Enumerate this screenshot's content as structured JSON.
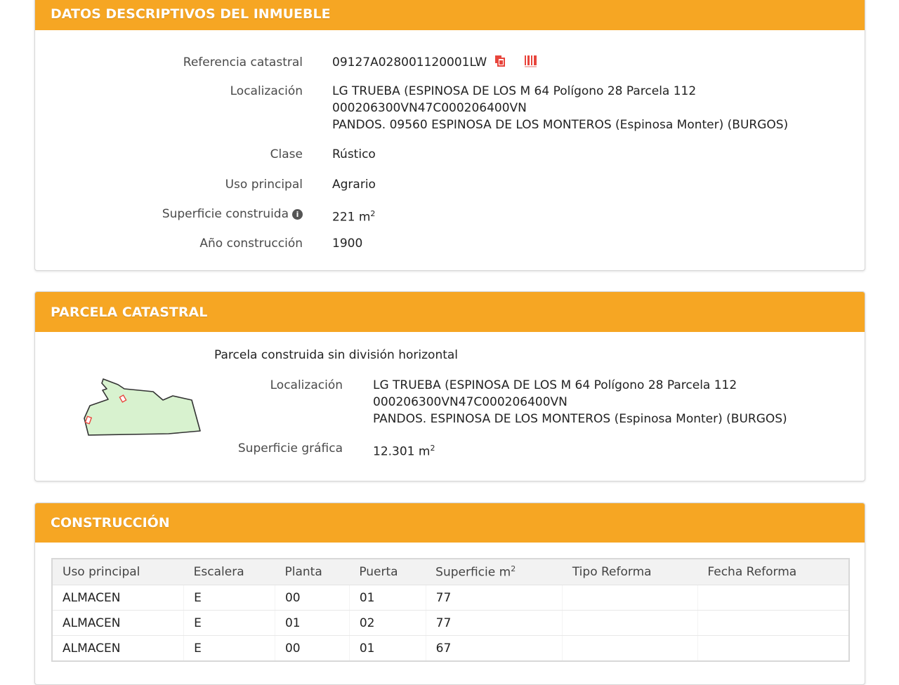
{
  "datos": {
    "title": "DATOS DESCRIPTIVOS DEL INMUEBLE",
    "ref_label": "Referencia catastral",
    "ref_value": "09127A028001120001LW",
    "loc_label": "Localización",
    "loc_line1": "LG TRUEBA (ESPINOSA DE LOS M 64 Polígono 28 Parcela 112",
    "loc_line2": "000206300VN47C000206400VN",
    "loc_line3": "PANDOS. 09560 ESPINOSA DE LOS MONTEROS (Espinosa Monter) (BURGOS)",
    "clase_label": "Clase",
    "clase_value": "Rústico",
    "uso_label": "Uso principal",
    "uso_value": "Agrario",
    "sup_label": "Superficie construida",
    "sup_value": "221 m",
    "sup_exp": "2",
    "anio_label": "Año construcción",
    "anio_value": "1900"
  },
  "parcela": {
    "title": "PARCELA CATASTRAL",
    "subtitle": "Parcela construida sin división horizontal",
    "loc_label": "Localización",
    "loc_line1": "LG TRUEBA (ESPINOSA DE LOS M 64 Polígono 28 Parcela 112",
    "loc_line2": "000206300VN47C000206400VN",
    "loc_line3": "PANDOS. ESPINOSA DE LOS MONTEROS (Espinosa Monter) (BURGOS)",
    "sup_label": "Superficie gráfica",
    "sup_value": "12.301 m",
    "sup_exp": "2"
  },
  "construccion": {
    "title": "CONSTRUCCIÓN",
    "headers": {
      "uso": "Uso principal",
      "escalera": "Escalera",
      "planta": "Planta",
      "puerta": "Puerta",
      "superficie": "Superficie m",
      "superficie_exp": "2",
      "tipo": "Tipo Reforma",
      "fecha": "Fecha Reforma"
    },
    "rows": [
      {
        "uso": "ALMACEN",
        "escalera": "E",
        "planta": "00",
        "puerta": "01",
        "superficie": "77",
        "tipo": "",
        "fecha": ""
      },
      {
        "uso": "ALMACEN",
        "escalera": "E",
        "planta": "01",
        "puerta": "02",
        "superficie": "77",
        "tipo": "",
        "fecha": ""
      },
      {
        "uso": "ALMACEN",
        "escalera": "E",
        "planta": "00",
        "puerta": "01",
        "superficie": "67",
        "tipo": "",
        "fecha": ""
      }
    ]
  },
  "colors": {
    "header_orange": "#f6a623",
    "icon_red": "#e8453c",
    "parcel_fill": "#d8f2cf"
  },
  "icons": [
    "copy-icon",
    "barcode-icon",
    "info-icon"
  ]
}
